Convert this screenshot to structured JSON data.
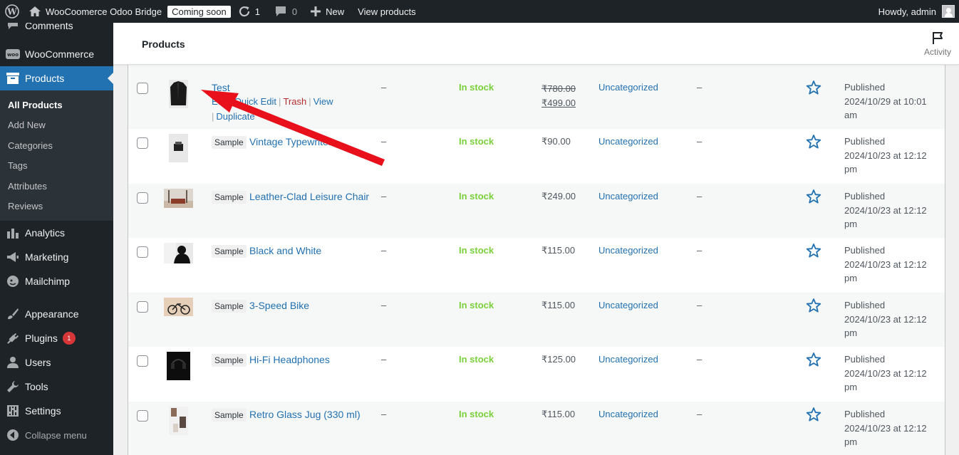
{
  "adminbar": {
    "site_name": "WooCoomerce Odoo Bridge",
    "coming_soon": "Coming soon",
    "updates_count": "1",
    "comments_count": "0",
    "new_label": "New",
    "view_products": "View products",
    "howdy": "Howdy, admin"
  },
  "sidebar": {
    "partial_top": "Comments",
    "woocommerce": "WooCommerce",
    "products": "Products",
    "submenu": [
      "All Products",
      "Add New",
      "Categories",
      "Tags",
      "Attributes",
      "Reviews"
    ],
    "analytics": "Analytics",
    "marketing": "Marketing",
    "mailchimp": "Mailchimp",
    "appearance": "Appearance",
    "plugins": "Plugins",
    "plugins_badge": "1",
    "users": "Users",
    "tools": "Tools",
    "settings": "Settings",
    "collapse": "Collapse menu"
  },
  "header": {
    "title": "Products",
    "activity": "Activity"
  },
  "row_actions": {
    "edit": "Edit",
    "quick_edit": "Quick Edit",
    "trash": "Trash",
    "view": "View",
    "duplicate": "Duplicate",
    "sep": "|"
  },
  "products": [
    {
      "name": "Test",
      "sku": "–",
      "stock": "In stock",
      "price": "₹780.00",
      "sale_price": "₹499.00",
      "category": "Uncategorized",
      "tags": "–",
      "status": "Published",
      "date": "2024/10/29 at 10:01",
      "time_suffix": "am"
    },
    {
      "sample": "Sample",
      "name": "Vintage Typewriter",
      "sku": "–",
      "stock": "In stock",
      "price": "₹90.00",
      "category": "Uncategorized",
      "tags": "–",
      "status": "Published",
      "date": "2024/10/23 at 12:12",
      "time_suffix": "pm"
    },
    {
      "sample": "Sample",
      "name": "Leather-Clad Leisure Chair",
      "sku": "–",
      "stock": "In stock",
      "price": "₹249.00",
      "category": "Uncategorized",
      "tags": "–",
      "status": "Published",
      "date": "2024/10/23 at 12:12",
      "time_suffix": "pm"
    },
    {
      "sample": "Sample",
      "name": "Black and White",
      "sku": "–",
      "stock": "In stock",
      "price": "₹115.00",
      "category": "Uncategorized",
      "tags": "–",
      "status": "Published",
      "date": "2024/10/23 at 12:12",
      "time_suffix": "pm"
    },
    {
      "sample": "Sample",
      "name": "3-Speed Bike",
      "sku": "–",
      "stock": "In stock",
      "price": "₹115.00",
      "category": "Uncategorized",
      "tags": "–",
      "status": "Published",
      "date": "2024/10/23 at 12:12",
      "time_suffix": "pm"
    },
    {
      "sample": "Sample",
      "name": "Hi-Fi Headphones",
      "sku": "–",
      "stock": "In stock",
      "price": "₹125.00",
      "category": "Uncategorized",
      "tags": "–",
      "status": "Published",
      "date": "2024/10/23 at 12:12",
      "time_suffix": "pm"
    },
    {
      "sample": "Sample",
      "name": "Retro Glass Jug (330 ml)",
      "sku": "–",
      "stock": "In stock",
      "price": "₹115.00",
      "category": "Uncategorized",
      "tags": "–",
      "status": "Published",
      "date": "2024/10/23 at 12:12",
      "time_suffix": "pm"
    }
  ],
  "colors": {
    "admin_dark": "#1d2327",
    "accent": "#2271b1",
    "in_stock": "#7ad03a",
    "trash": "#b32d2e",
    "annotation_arrow": "#e8101a"
  }
}
